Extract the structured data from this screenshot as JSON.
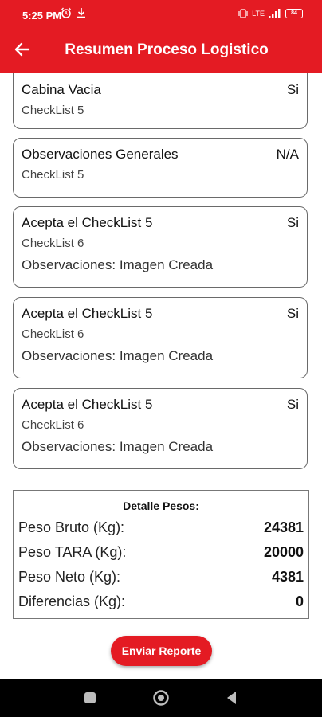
{
  "status": {
    "time": "5:25 PM",
    "network": "LTE",
    "battery": "84"
  },
  "header": {
    "title": "Resumen Proceso Logistico"
  },
  "cards": [
    {
      "name": "Cabina Vacia",
      "value": "Si",
      "checklist": "CheckList 5"
    },
    {
      "name": "Observaciones Generales",
      "value": "N/A",
      "checklist": "CheckList 5"
    },
    {
      "name": "Acepta el CheckList 5",
      "value": "Si",
      "checklist": "CheckList 6",
      "observations": "Observaciones: Imagen Creada"
    },
    {
      "name": "Acepta el CheckList 5",
      "value": "Si",
      "checklist": "CheckList 6",
      "observations": "Observaciones: Imagen Creada"
    },
    {
      "name": "Acepta el CheckList 5",
      "value": "Si",
      "checklist": "CheckList 6",
      "observations": "Observaciones: Imagen Creada"
    }
  ],
  "weights": {
    "title": "Detalle Pesos:",
    "rows": [
      {
        "label": "Peso Bruto (Kg):",
        "value": "24381"
      },
      {
        "label": "Peso TARA (Kg):",
        "value": "20000"
      },
      {
        "label": "Peso Neto (Kg):",
        "value": "4381"
      },
      {
        "label": "Diferencias (Kg):",
        "value": "0"
      }
    ]
  },
  "actions": {
    "send_label": "Enviar Reporte"
  },
  "colors": {
    "primary": "#e41b23"
  }
}
